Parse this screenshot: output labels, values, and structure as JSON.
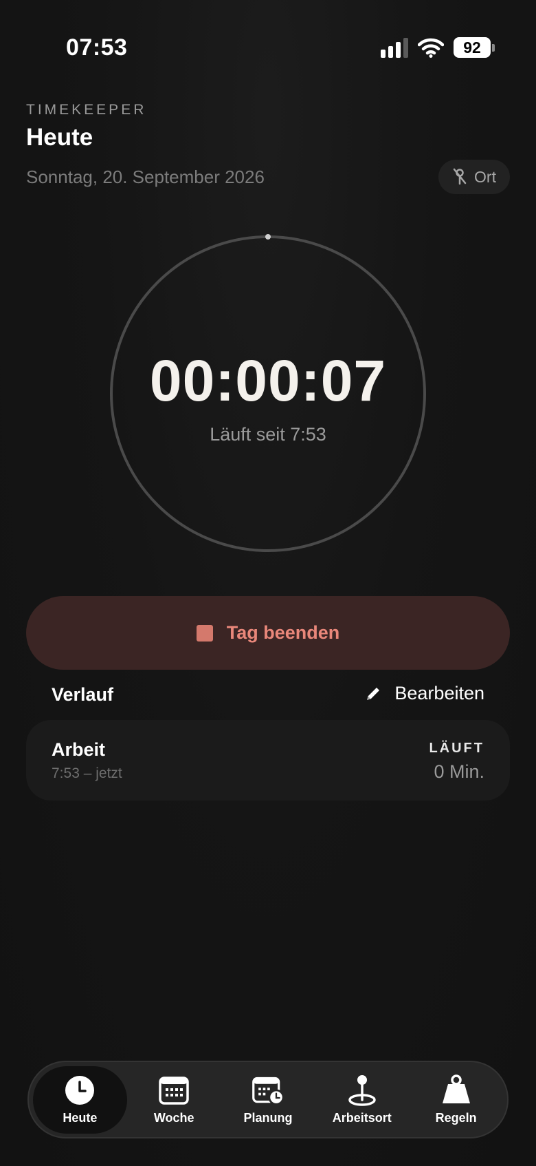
{
  "status_bar": {
    "time": "07:53",
    "battery": "92"
  },
  "header": {
    "app_label": "TIMEKEEPER",
    "title": "Heute",
    "date": "Sonntag, 20. September 2026",
    "location_chip": "Ort"
  },
  "timer": {
    "value": "00:00:07",
    "subtitle": "Läuft seit 7:53"
  },
  "actions": {
    "end_day": "Tag beenden"
  },
  "history": {
    "title": "Verlauf",
    "edit_label": "Bearbeiten",
    "entries": [
      {
        "name": "Arbeit",
        "range": "7:53 – jetzt",
        "status": "LÄUFT",
        "duration": "0 Min."
      }
    ]
  },
  "tabs": [
    {
      "label": "Heute",
      "icon": "clock-icon",
      "active": true
    },
    {
      "label": "Woche",
      "icon": "calendar-icon",
      "active": false
    },
    {
      "label": "Planung",
      "icon": "calendar-clock-icon",
      "active": false
    },
    {
      "label": "Arbeitsort",
      "icon": "location-pin-icon",
      "active": false
    },
    {
      "label": "Regeln",
      "icon": "weight-icon",
      "active": false
    }
  ],
  "colors": {
    "accent": "#e9877a",
    "button_bg": "#3b2524",
    "background": "#141414"
  }
}
